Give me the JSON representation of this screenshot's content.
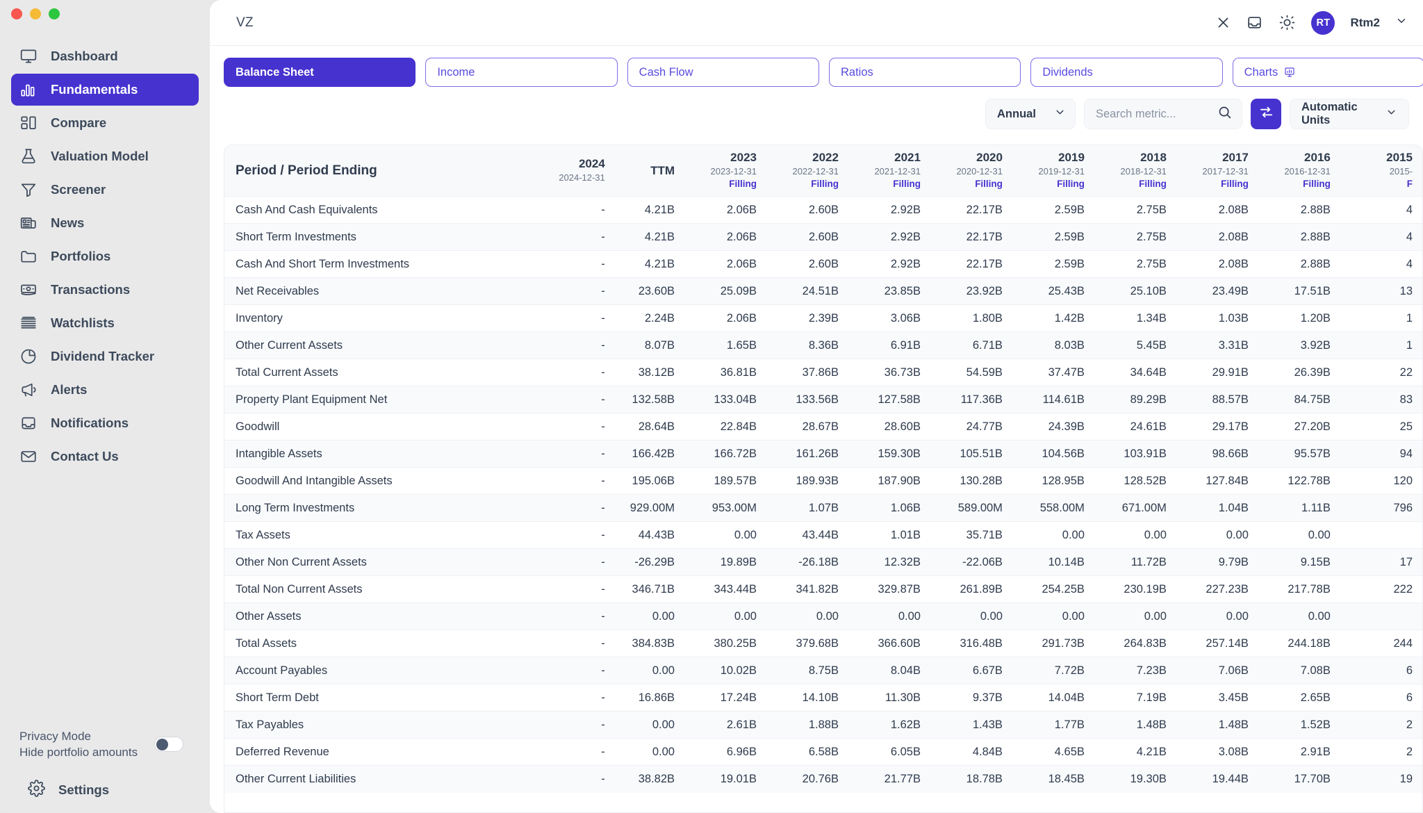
{
  "window": {
    "traffic_lights": [
      "close",
      "minimize",
      "zoom"
    ]
  },
  "sidebar": {
    "items": [
      {
        "label": "Dashboard",
        "icon": "monitor-icon",
        "active": false
      },
      {
        "label": "Fundamentals",
        "icon": "bar-chart-icon",
        "active": true
      },
      {
        "label": "Compare",
        "icon": "compare-icon",
        "active": false
      },
      {
        "label": "Valuation Model",
        "icon": "flask-icon",
        "active": false
      },
      {
        "label": "Screener",
        "icon": "funnel-icon",
        "active": false
      },
      {
        "label": "News",
        "icon": "newspaper-icon",
        "active": false
      },
      {
        "label": "Portfolios",
        "icon": "folder-icon",
        "active": false
      },
      {
        "label": "Transactions",
        "icon": "banknote-icon",
        "active": false
      },
      {
        "label": "Watchlists",
        "icon": "layers-icon",
        "active": false
      },
      {
        "label": "Dividend Tracker",
        "icon": "pie-chart-icon",
        "active": false
      },
      {
        "label": "Alerts",
        "icon": "megaphone-icon",
        "active": false
      },
      {
        "label": "Notifications",
        "icon": "inbox-icon",
        "active": false
      },
      {
        "label": "Contact Us",
        "icon": "mail-icon",
        "active": false
      }
    ],
    "privacy": {
      "title": "Privacy Mode",
      "subtitle": "Hide portfolio amounts",
      "toggle_on": false
    },
    "settings_label": "Settings"
  },
  "topbar": {
    "ticker": "VZ",
    "close_icon": "close-icon",
    "inbox_icon": "inbox-icon",
    "theme_icon": "sun-icon",
    "avatar_initials": "RT",
    "username": "Rtm2",
    "chevron_icon": "chevron-down-icon"
  },
  "tabs": [
    {
      "label": "Balance Sheet",
      "active": true
    },
    {
      "label": "Income",
      "active": false
    },
    {
      "label": "Cash Flow",
      "active": false
    },
    {
      "label": "Ratios",
      "active": false
    },
    {
      "label": "Dividends",
      "active": false
    },
    {
      "label": "Charts",
      "active": false,
      "icon": "chart-icon"
    }
  ],
  "controls": {
    "period": {
      "value": "Annual",
      "icon": "chevron-down-icon"
    },
    "search": {
      "value": "",
      "placeholder": "Search metric...",
      "icon": "search-icon"
    },
    "swap": {
      "icon": "swap-arrows-icon"
    },
    "units": {
      "value": "Automatic Units",
      "icon": "chevron-down-icon"
    }
  },
  "table": {
    "metric_header": "Period / Period Ending",
    "columns": [
      {
        "year": "2024",
        "date": "2024-12-31",
        "filling": ""
      },
      {
        "year": "",
        "date": "",
        "filling": "",
        "ttm": "TTM"
      },
      {
        "year": "2023",
        "date": "2023-12-31",
        "filling": "Filling"
      },
      {
        "year": "2022",
        "date": "2022-12-31",
        "filling": "Filling"
      },
      {
        "year": "2021",
        "date": "2021-12-31",
        "filling": "Filling"
      },
      {
        "year": "2020",
        "date": "2020-12-31",
        "filling": "Filling"
      },
      {
        "year": "2019",
        "date": "2019-12-31",
        "filling": "Filling"
      },
      {
        "year": "2018",
        "date": "2018-12-31",
        "filling": "Filling"
      },
      {
        "year": "2017",
        "date": "2017-12-31",
        "filling": "Filling"
      },
      {
        "year": "2016",
        "date": "2016-12-31",
        "filling": "Filling"
      },
      {
        "year": "2015",
        "date": "2015-",
        "filling": "F"
      }
    ],
    "rows": [
      {
        "metric": "Cash And Cash Equivalents",
        "values": [
          "-",
          "4.21B",
          "2.06B",
          "2.60B",
          "2.92B",
          "22.17B",
          "2.59B",
          "2.75B",
          "2.08B",
          "2.88B",
          "4"
        ]
      },
      {
        "metric": "Short Term Investments",
        "values": [
          "-",
          "4.21B",
          "2.06B",
          "2.60B",
          "2.92B",
          "22.17B",
          "2.59B",
          "2.75B",
          "2.08B",
          "2.88B",
          "4"
        ]
      },
      {
        "metric": "Cash And Short Term Investments",
        "values": [
          "-",
          "4.21B",
          "2.06B",
          "2.60B",
          "2.92B",
          "22.17B",
          "2.59B",
          "2.75B",
          "2.08B",
          "2.88B",
          "4"
        ]
      },
      {
        "metric": "Net Receivables",
        "values": [
          "-",
          "23.60B",
          "25.09B",
          "24.51B",
          "23.85B",
          "23.92B",
          "25.43B",
          "25.10B",
          "23.49B",
          "17.51B",
          "13"
        ]
      },
      {
        "metric": "Inventory",
        "values": [
          "-",
          "2.24B",
          "2.06B",
          "2.39B",
          "3.06B",
          "1.80B",
          "1.42B",
          "1.34B",
          "1.03B",
          "1.20B",
          "1"
        ]
      },
      {
        "metric": "Other Current Assets",
        "values": [
          "-",
          "8.07B",
          "1.65B",
          "8.36B",
          "6.91B",
          "6.71B",
          "8.03B",
          "5.45B",
          "3.31B",
          "3.92B",
          "1"
        ]
      },
      {
        "metric": "Total Current Assets",
        "values": [
          "-",
          "38.12B",
          "36.81B",
          "37.86B",
          "36.73B",
          "54.59B",
          "37.47B",
          "34.64B",
          "29.91B",
          "26.39B",
          "22"
        ]
      },
      {
        "metric": "Property Plant Equipment Net",
        "values": [
          "-",
          "132.58B",
          "133.04B",
          "133.56B",
          "127.58B",
          "117.36B",
          "114.61B",
          "89.29B",
          "88.57B",
          "84.75B",
          "83"
        ]
      },
      {
        "metric": "Goodwill",
        "values": [
          "-",
          "28.64B",
          "22.84B",
          "28.67B",
          "28.60B",
          "24.77B",
          "24.39B",
          "24.61B",
          "29.17B",
          "27.20B",
          "25"
        ]
      },
      {
        "metric": "Intangible Assets",
        "values": [
          "-",
          "166.42B",
          "166.72B",
          "161.26B",
          "159.30B",
          "105.51B",
          "104.56B",
          "103.91B",
          "98.66B",
          "95.57B",
          "94"
        ]
      },
      {
        "metric": "Goodwill And Intangible Assets",
        "values": [
          "-",
          "195.06B",
          "189.57B",
          "189.93B",
          "187.90B",
          "130.28B",
          "128.95B",
          "128.52B",
          "127.84B",
          "122.78B",
          "120"
        ]
      },
      {
        "metric": "Long Term Investments",
        "values": [
          "-",
          "929.00M",
          "953.00M",
          "1.07B",
          "1.06B",
          "589.00M",
          "558.00M",
          "671.00M",
          "1.04B",
          "1.11B",
          "796"
        ]
      },
      {
        "metric": "Tax Assets",
        "values": [
          "-",
          "44.43B",
          "0.00",
          "43.44B",
          "1.01B",
          "35.71B",
          "0.00",
          "0.00",
          "0.00",
          "0.00",
          ""
        ]
      },
      {
        "metric": "Other Non Current Assets",
        "values": [
          "-",
          "-26.29B",
          "19.89B",
          "-26.18B",
          "12.32B",
          "-22.06B",
          "10.14B",
          "11.72B",
          "9.79B",
          "9.15B",
          "17"
        ]
      },
      {
        "metric": "Total Non Current Assets",
        "values": [
          "-",
          "346.71B",
          "343.44B",
          "341.82B",
          "329.87B",
          "261.89B",
          "254.25B",
          "230.19B",
          "227.23B",
          "217.78B",
          "222"
        ]
      },
      {
        "metric": "Other Assets",
        "values": [
          "-",
          "0.00",
          "0.00",
          "0.00",
          "0.00",
          "0.00",
          "0.00",
          "0.00",
          "0.00",
          "0.00",
          ""
        ]
      },
      {
        "metric": "Total Assets",
        "values": [
          "-",
          "384.83B",
          "380.25B",
          "379.68B",
          "366.60B",
          "316.48B",
          "291.73B",
          "264.83B",
          "257.14B",
          "244.18B",
          "244"
        ]
      },
      {
        "metric": "Account Payables",
        "values": [
          "-",
          "0.00",
          "10.02B",
          "8.75B",
          "8.04B",
          "6.67B",
          "7.72B",
          "7.23B",
          "7.06B",
          "7.08B",
          "6"
        ]
      },
      {
        "metric": "Short Term Debt",
        "values": [
          "-",
          "16.86B",
          "17.24B",
          "14.10B",
          "11.30B",
          "9.37B",
          "14.04B",
          "7.19B",
          "3.45B",
          "2.65B",
          "6"
        ]
      },
      {
        "metric": "Tax Payables",
        "values": [
          "-",
          "0.00",
          "2.61B",
          "1.88B",
          "1.62B",
          "1.43B",
          "1.77B",
          "1.48B",
          "1.48B",
          "1.52B",
          "2"
        ]
      },
      {
        "metric": "Deferred Revenue",
        "values": [
          "-",
          "0.00",
          "6.96B",
          "6.58B",
          "6.05B",
          "4.84B",
          "4.65B",
          "4.21B",
          "3.08B",
          "2.91B",
          "2"
        ]
      },
      {
        "metric": "Other Current Liabilities",
        "values": [
          "-",
          "38.82B",
          "19.01B",
          "20.76B",
          "21.77B",
          "18.78B",
          "18.45B",
          "19.30B",
          "19.44B",
          "17.70B",
          "19"
        ]
      }
    ]
  }
}
